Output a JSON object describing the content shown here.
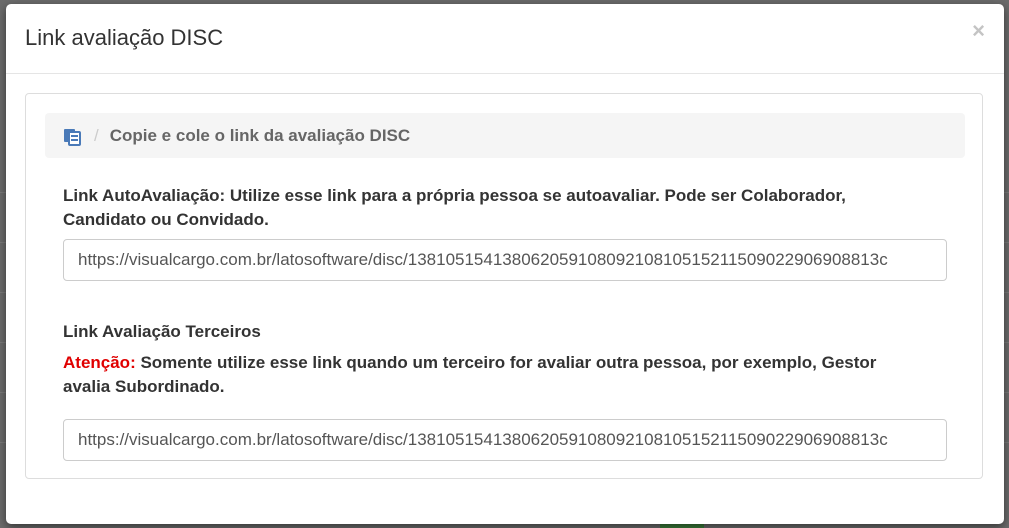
{
  "modal": {
    "title": "Link avaliação DISC",
    "close_label": "×"
  },
  "breadcrumb": {
    "icon": "copy-icon",
    "separator": "/",
    "text": "Copie e cole o link da avaliação DISC"
  },
  "auto_section": {
    "label": "Link AutoAvaliação: Utilize esse link para a própria pessoa se autoavaliar. Pode ser Colaborador, Candidato ou Convidado.",
    "url": "https://visualcargo.com.br/latosoftware/disc/13810515413806205910809210810515211509022906908813c"
  },
  "third_party_section": {
    "label": "Link Avaliação Terceiros",
    "warning_prefix": "Atenção:",
    "warning_text": " Somente utilize esse link quando um terceiro for avaliar outra pessoa, por exemplo, Gestor avalia Subordinado.",
    "url": "https://visualcargo.com.br/latosoftware/disc/13810515413806205910809210810515211509022906908813c"
  },
  "colors": {
    "warning": "#e00000",
    "icon": "#4a7ab8"
  }
}
